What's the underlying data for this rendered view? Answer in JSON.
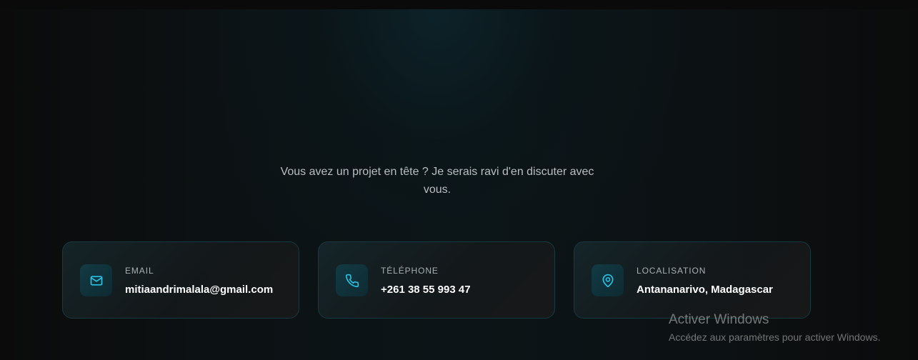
{
  "contact": {
    "intro_text": "Vous avez un projet en tête ? Je serais ravi d'en discuter avec vous.",
    "accent_color": "#22c3e6",
    "cards": [
      {
        "icon": "mail-icon",
        "label": "EMAIL",
        "value": "mitiaandrimalala@gmail.com"
      },
      {
        "icon": "phone-icon",
        "label": "TÉLÉPHONE",
        "value": "+261 38 55 993 47"
      },
      {
        "icon": "map-pin-icon",
        "label": "LOCALISATION",
        "value": "Antananarivo, Madagascar"
      }
    ]
  },
  "windows_activation": {
    "title": "Activer Windows",
    "subtitle": "Accédez aux paramètres pour activer Windows."
  }
}
